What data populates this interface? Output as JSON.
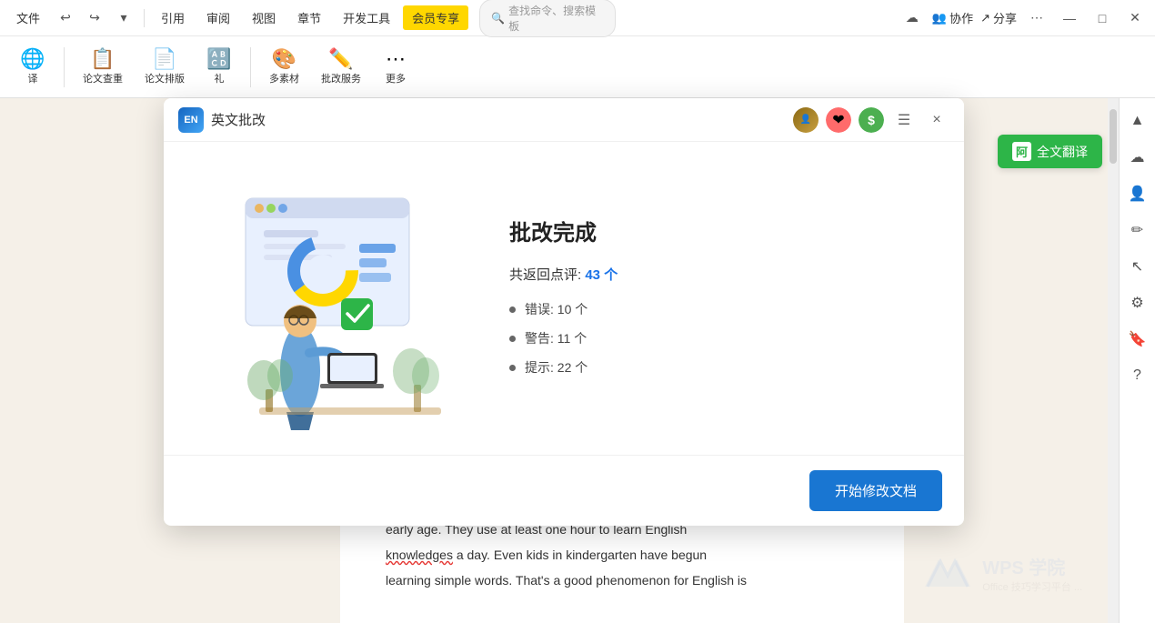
{
  "toolbar": {
    "menu_items": [
      {
        "label": "文件",
        "active": false
      },
      {
        "label": "引用",
        "active": false
      },
      {
        "label": "审阅",
        "active": false
      },
      {
        "label": "视图",
        "active": false
      },
      {
        "label": "章节",
        "active": false
      },
      {
        "label": "开发工具",
        "active": false
      },
      {
        "label": "会员专享",
        "active": true
      }
    ],
    "search_placeholder": "查找命令、搜索模板",
    "right_items": [
      "协作",
      "分享"
    ],
    "tools": [
      {
        "icon": "🌐",
        "label": "译"
      },
      {
        "icon": "📋",
        "label": "论文查重"
      },
      {
        "icon": "📄",
        "label": "论文排版"
      },
      {
        "icon": "🎨",
        "label": "多素材"
      },
      {
        "icon": "✏️",
        "label": "批改服务"
      },
      {
        "icon": "⋯",
        "label": "更多"
      }
    ]
  },
  "dialog": {
    "logo_text": "EN",
    "title": "英文批改",
    "close_label": "×",
    "result": {
      "title": "批改完成",
      "summary_prefix": "共返回点评: ",
      "summary_count": "43 个",
      "items": [
        {
          "label": "错误: 10 个"
        },
        {
          "label": "警告: 11 个"
        },
        {
          "label": "提示: 22 个"
        }
      ]
    },
    "button_label": "开始修改文档"
  },
  "translation_btn": {
    "icon": "阿",
    "label": "全文翻译"
  },
  "doc": {
    "text1": "early age. They use at least one hour to learn English",
    "text2_prefix": "",
    "knowledges_word": "knowledges",
    "text2": " a day. Even kids in kindergarten have begun",
    "text3": "learning simple words. That's a good phenomenon for English is"
  },
  "watermark": {
    "logo": "W",
    "brand": "WPS 学院",
    "sub": "Office 技巧学习平台 ..."
  }
}
